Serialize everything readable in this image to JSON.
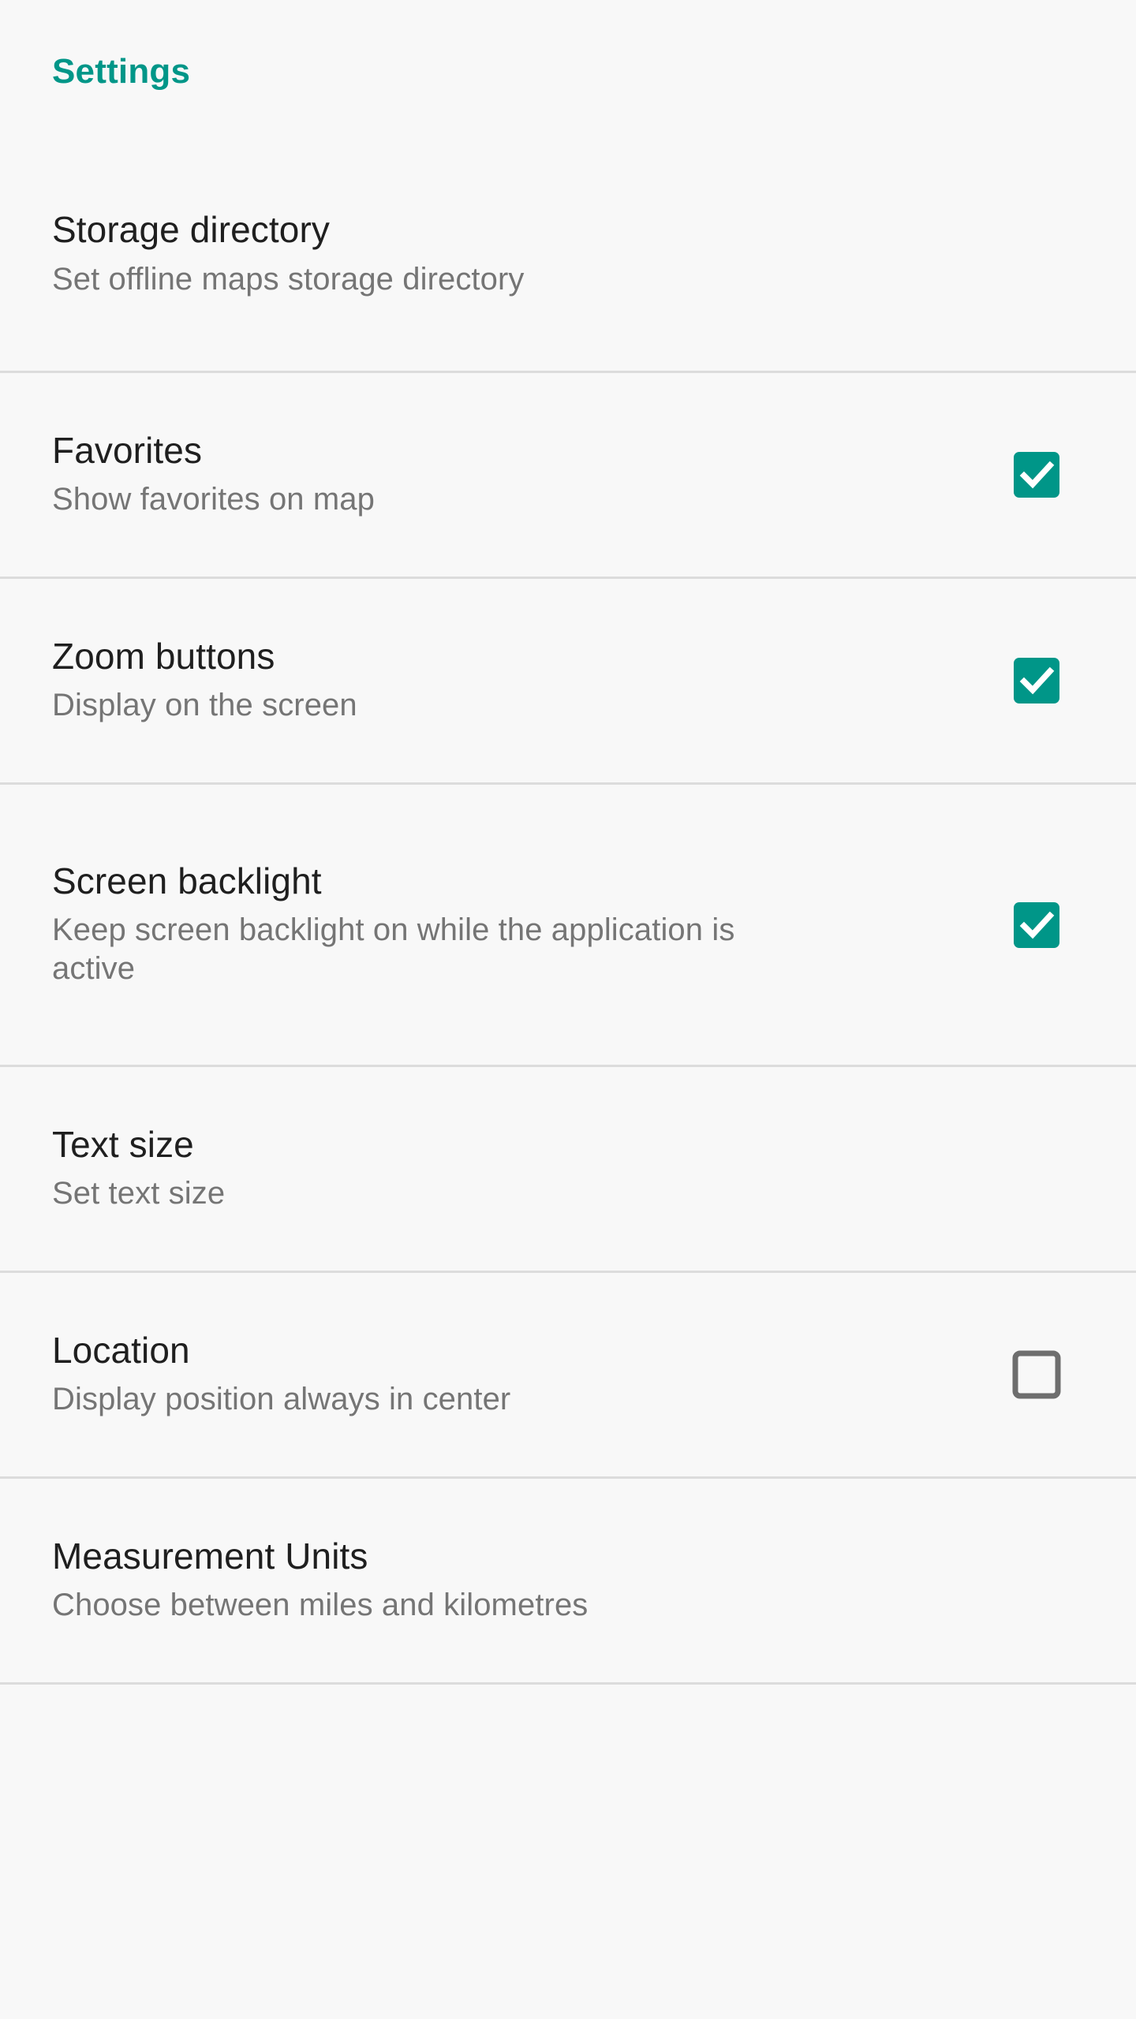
{
  "screen": {
    "background_color": "#f8f8f8",
    "accent_color": "#009688",
    "divider_color": "#dcdcdc",
    "title_color": "#1f1f1f",
    "summary_color": "#757575",
    "unchecked_box_color": "#6e6e6e"
  },
  "header": {
    "title": "Settings"
  },
  "preferences": [
    {
      "key": "storage-directory",
      "title": "Storage directory",
      "summary": "Set offline maps storage directory",
      "widget": "none",
      "checked": null
    },
    {
      "key": "favorites",
      "title": "Favorites",
      "summary": "Show favorites on map",
      "widget": "checkbox",
      "checked": true
    },
    {
      "key": "zoom-buttons",
      "title": "Zoom buttons",
      "summary": "Display on the screen",
      "widget": "checkbox",
      "checked": true
    },
    {
      "key": "screen-backlight",
      "title": "Screen backlight",
      "summary": "Keep screen backlight on while the application is active",
      "widget": "checkbox",
      "checked": true
    },
    {
      "key": "text-size",
      "title": "Text size",
      "summary": "Set text size",
      "widget": "none",
      "checked": null
    },
    {
      "key": "location",
      "title": "Location",
      "summary": "Display position always in center",
      "widget": "checkbox",
      "checked": false
    },
    {
      "key": "measurement-units",
      "title": "Measurement Units",
      "summary": "Choose between miles and kilometres",
      "widget": "none",
      "checked": null
    }
  ]
}
